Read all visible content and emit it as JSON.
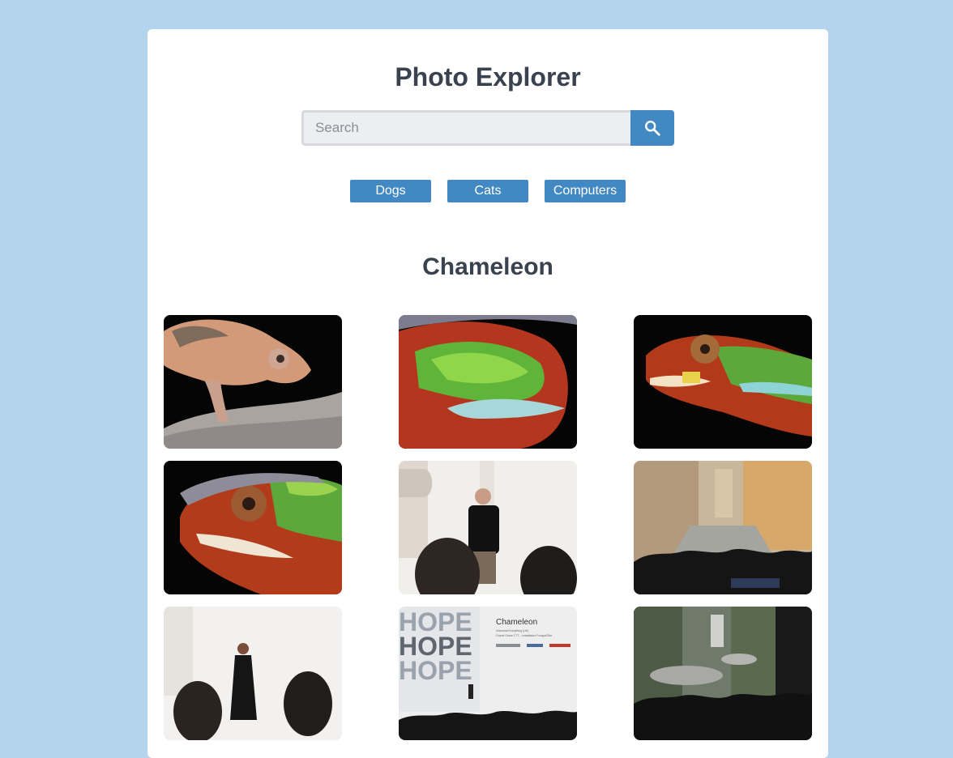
{
  "header": {
    "title": "Photo Explorer"
  },
  "search": {
    "placeholder": "Search",
    "value": "",
    "button_icon": "search-icon"
  },
  "tags": [
    "Dogs",
    "Cats",
    "Computers"
  ],
  "gallery": {
    "heading": "Chameleon",
    "photos": [
      {
        "subject": "pale chameleon on branch"
      },
      {
        "subject": "green and red chameleon skin close-up"
      },
      {
        "subject": "chameleon with open mouth"
      },
      {
        "subject": "colorful chameleon head"
      },
      {
        "subject": "speaker on stage"
      },
      {
        "subject": "audience watching stair projection"
      },
      {
        "subject": "woman speaking on stage"
      },
      {
        "subject": "conference stage with HOPE wall"
      },
      {
        "subject": "audience watching garden projection"
      }
    ],
    "stage_slide": {
      "title": "Chameleon",
      "line1": "Universal Everything (UK)",
      "line2": "Gravel Grace CTT – Installation Footgal/Oke",
      "wall_text": "HOPE"
    }
  },
  "colors": {
    "background": "#b3d4ec",
    "accent": "#4289c3",
    "text": "#39424e"
  }
}
